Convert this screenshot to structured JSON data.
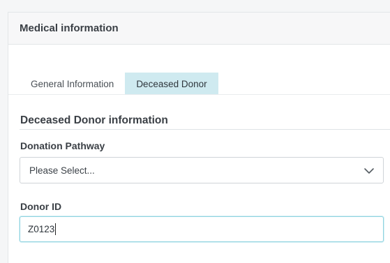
{
  "panel": {
    "title": "Medical information"
  },
  "tabs": [
    {
      "label": "General Information",
      "active": false
    },
    {
      "label": "Deceased Donor",
      "active": true
    }
  ],
  "section": {
    "title": "Deceased Donor information"
  },
  "fields": {
    "donation_pathway": {
      "label": "Donation Pathway",
      "selected": "Please Select..."
    },
    "donor_id": {
      "label": "Donor ID",
      "value": "Z0123"
    }
  },
  "icons": {
    "select_chevron": "chevron-down-icon"
  },
  "colors": {
    "active_tab_bg": "#cfeaf0",
    "focus_border": "#8fd3e0"
  }
}
